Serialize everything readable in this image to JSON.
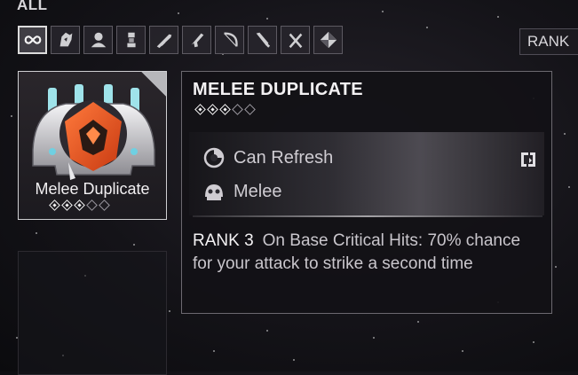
{
  "category_label": "ALL",
  "filters": [
    {
      "icon": "infinity-icon",
      "active": true
    },
    {
      "icon": "warframe-helmet-icon",
      "active": false
    },
    {
      "icon": "companion-icon",
      "active": false
    },
    {
      "icon": "robotic-icon",
      "active": false
    },
    {
      "icon": "primary-weapon-icon",
      "active": false
    },
    {
      "icon": "secondary-weapon-icon",
      "active": false
    },
    {
      "icon": "bow-icon",
      "active": false
    },
    {
      "icon": "melee-weapon-icon",
      "active": false
    },
    {
      "icon": "crossed-swords-icon",
      "active": false
    },
    {
      "icon": "diamond-checker-icon",
      "active": false
    }
  ],
  "sort_tab_label": "RANK",
  "mod_card": {
    "name": "Melee Duplicate",
    "rank": 3,
    "max_rank": 5
  },
  "detail": {
    "title": "MELEE DUPLICATE",
    "rank": 3,
    "max_rank": 5,
    "refresh_label": "Can Refresh",
    "type_label": "Melee",
    "rank_label": "RANK 3",
    "description": "On Base Critical Hits: 70% chance for your attack to strike a second time"
  },
  "colors": {
    "accent_orange": "#e8521f",
    "pip_filled": "#f4f4f4",
    "border": "#cfcfd2"
  }
}
